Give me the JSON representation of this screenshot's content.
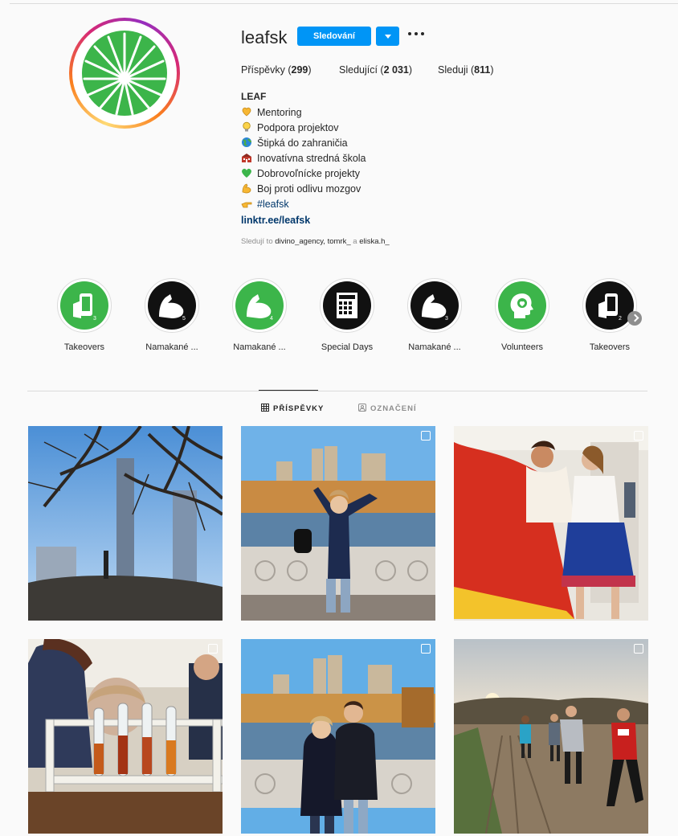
{
  "profile": {
    "username": "leafsk",
    "follow_label": "Sledování",
    "stats": {
      "posts_label": "Příspěvky",
      "posts_count": "299",
      "followers_label": "Sledující",
      "followers_count": "2 031",
      "following_label": "Sleduji",
      "following_count": "811"
    },
    "bio": {
      "name": "LEAF",
      "lines": [
        {
          "icon": "heart-hands-icon",
          "text": "Mentoring"
        },
        {
          "icon": "lightbulb-icon",
          "text": "Podpora projektov"
        },
        {
          "icon": "globe-icon",
          "text": "Štipká do zahraničia"
        },
        {
          "icon": "school-icon",
          "text": "Inovatívna stredná škola"
        },
        {
          "icon": "green-heart-icon",
          "text": "Dobrovoľnícke projekty"
        },
        {
          "icon": "flexed-biceps-icon",
          "text": "Boj proti odlivu mozgov"
        },
        {
          "icon": "pointing-hand-icon",
          "text": "#leafsk"
        }
      ],
      "link": "linktr.ee/leafsk",
      "followed_by_prefix": "Sledují to",
      "followed_by_users": "divino_agency, tomrk_",
      "followed_by_and": "a",
      "followed_by_last": "eliska.h_"
    }
  },
  "highlights": [
    {
      "label": "Takeovers",
      "icon": "phone-hand-icon",
      "style": "green"
    },
    {
      "label": "Namakané ...",
      "icon": "flexed-biceps-icon",
      "style": "black"
    },
    {
      "label": "Namakané ...",
      "icon": "flexed-biceps-icon",
      "style": "green"
    },
    {
      "label": "Special Days",
      "icon": "calendar-icon",
      "style": "black"
    },
    {
      "label": "Namakané ...",
      "icon": "flexed-biceps-icon",
      "style": "black"
    },
    {
      "label": "Volunteers",
      "icon": "head-heart-icon",
      "style": "green"
    },
    {
      "label": "Takeovers",
      "icon": "phone-hand-icon",
      "style": "black"
    }
  ],
  "tabs": [
    {
      "label": "PŘÍSPĚVKY",
      "icon": "grid-icon",
      "active": true
    },
    {
      "label": "OZNAČENÍ",
      "icon": "tag-icon",
      "active": false
    }
  ],
  "colors": {
    "accent": "#0095f6",
    "leaf_green": "#3cb54a",
    "background": "#fafafa"
  }
}
